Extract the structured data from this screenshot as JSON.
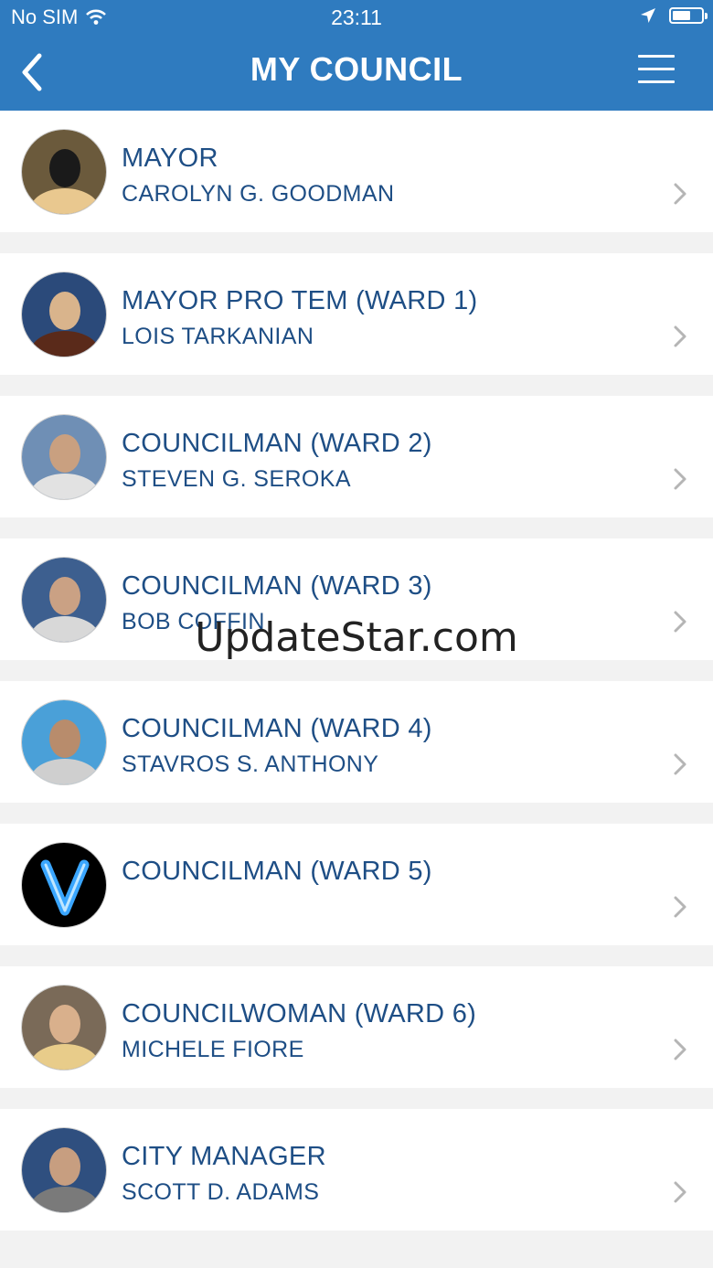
{
  "status_bar": {
    "carrier": "No SIM",
    "time": "23:11",
    "icons": [
      "wifi-icon",
      "location-arrow-icon",
      "battery-icon"
    ]
  },
  "nav": {
    "title": "MY COUNCIL",
    "back_icon": "chevron-left-icon",
    "menu_icon": "hamburger-menu-icon"
  },
  "members": [
    {
      "role": "MAYOR",
      "name": "CAROLYN G. GOODMAN",
      "avatar": "portrait-photo"
    },
    {
      "role": "MAYOR PRO TEM (WARD 1)",
      "name": "LOIS TARKANIAN",
      "avatar": "portrait-photo"
    },
    {
      "role": "COUNCILMAN (WARD 2)",
      "name": "STEVEN G. SEROKA",
      "avatar": "portrait-photo"
    },
    {
      "role": "COUNCILMAN (WARD 3)",
      "name": "BOB COFFIN",
      "avatar": "portrait-photo"
    },
    {
      "role": "COUNCILMAN (WARD 4)",
      "name": "STAVROS S. ANTHONY",
      "avatar": "portrait-photo"
    },
    {
      "role": "COUNCILMAN (WARD 5)",
      "name": "",
      "avatar": "v-logo"
    },
    {
      "role": "COUNCILWOMAN (WARD 6)",
      "name": "MICHELE FIORE",
      "avatar": "portrait-photo"
    },
    {
      "role": "CITY MANAGER",
      "name": "SCOTT D. ADAMS",
      "avatar": "portrait-photo"
    }
  ],
  "watermark": "UpdateStar.com",
  "colors": {
    "header": "#2f7bbf",
    "text": "#1e4e85",
    "background": "#f2f2f2",
    "chevron": "#b5b5b5"
  }
}
